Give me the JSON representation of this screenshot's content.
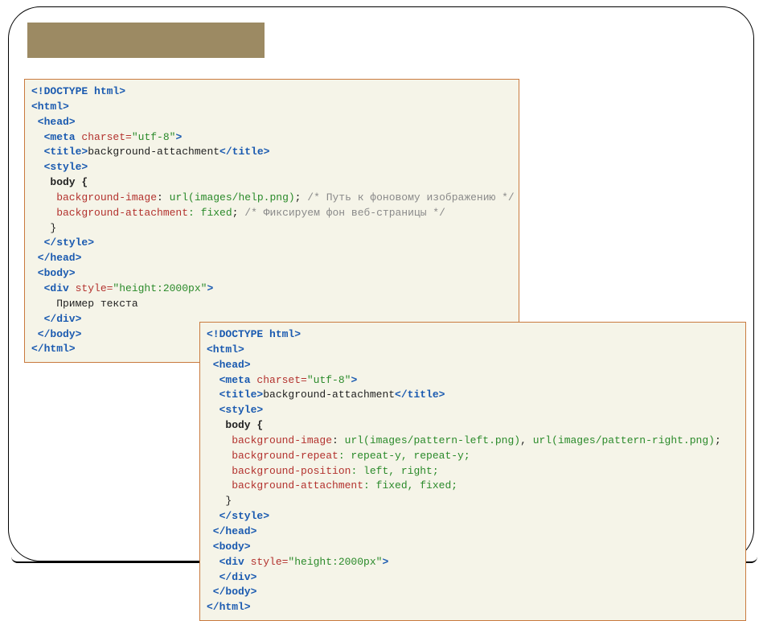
{
  "code1": {
    "l1_doctype": "<!DOCTYPE html>",
    "l2_html_o": "<html>",
    "l3_head_o": " <head>",
    "l4_meta_o": "  <meta ",
    "l4_attr": "charset=",
    "l4_val": "\"utf-8\"",
    "l4_close": ">",
    "l5_title_o": "  <title>",
    "l5_text": "background-attachment",
    "l5_title_c": "</title>",
    "l6_style_o": "  <style>",
    "l7_body": "   body {",
    "l8_prop": "    background-image",
    "l8_colon": ": ",
    "l8_url": "url(images/help.png)",
    "l8_semi": ";",
    "l8_comment": " /* Путь к фоновому изображению */",
    "l9_prop": "    background-attachment",
    "l9_val": ": fixed",
    "l9_semi": ";",
    "l9_comment": " /* Фиксируем фон веб-страницы */",
    "l10_brace": "   }",
    "l11_style_c": "  </style>",
    "l12_head_c": " </head>",
    "l13_body_o": " <body>",
    "l14_div_o": "  <div ",
    "l14_attr": "style=",
    "l14_val": "\"height:2000px\"",
    "l14_close": ">",
    "l15_text": "    Пример текста",
    "l16_div_c": "  </div>",
    "l17_body_c": " </body>",
    "l18_html_c": "</html>"
  },
  "code2": {
    "l1_doctype": "<!DOCTYPE html>",
    "l2_html_o": "<html>",
    "l3_head_o": " <head>",
    "l4_meta_o": "  <meta ",
    "l4_attr": "charset=",
    "l4_val": "\"utf-8\"",
    "l4_close": ">",
    "l5_title_o": "  <title>",
    "l5_text": "background-attachment",
    "l5_title_c": "</title>",
    "l6_style_o": "  <style>",
    "l7_body": "   body {",
    "l8_prop": "    background-image",
    "l8_colon": ": ",
    "l8_url1": "url(images/pattern-left.png)",
    "l8_sep": ", ",
    "l8_url2": "url(images/pattern-right.png)",
    "l8_semi": ";",
    "l9_prop": "    background-repeat",
    "l9_val": ": repeat-y, repeat-y;",
    "l10_prop": "    background-position",
    "l10_val": ": left, right;",
    "l11_prop": "    background-attachment",
    "l11_val": ": fixed, fixed;",
    "l12_brace": "   }",
    "l13_style_c": "  </style>",
    "l14_head_c": " </head>",
    "l15_body_o": " <body>",
    "l16_div_o": "  <div ",
    "l16_attr": "style=",
    "l16_val": "\"height:2000px\"",
    "l16_close": ">",
    "l17_div_c": "  </div>",
    "l18_body_c": " </body>",
    "l19_html_c": "</html>"
  }
}
